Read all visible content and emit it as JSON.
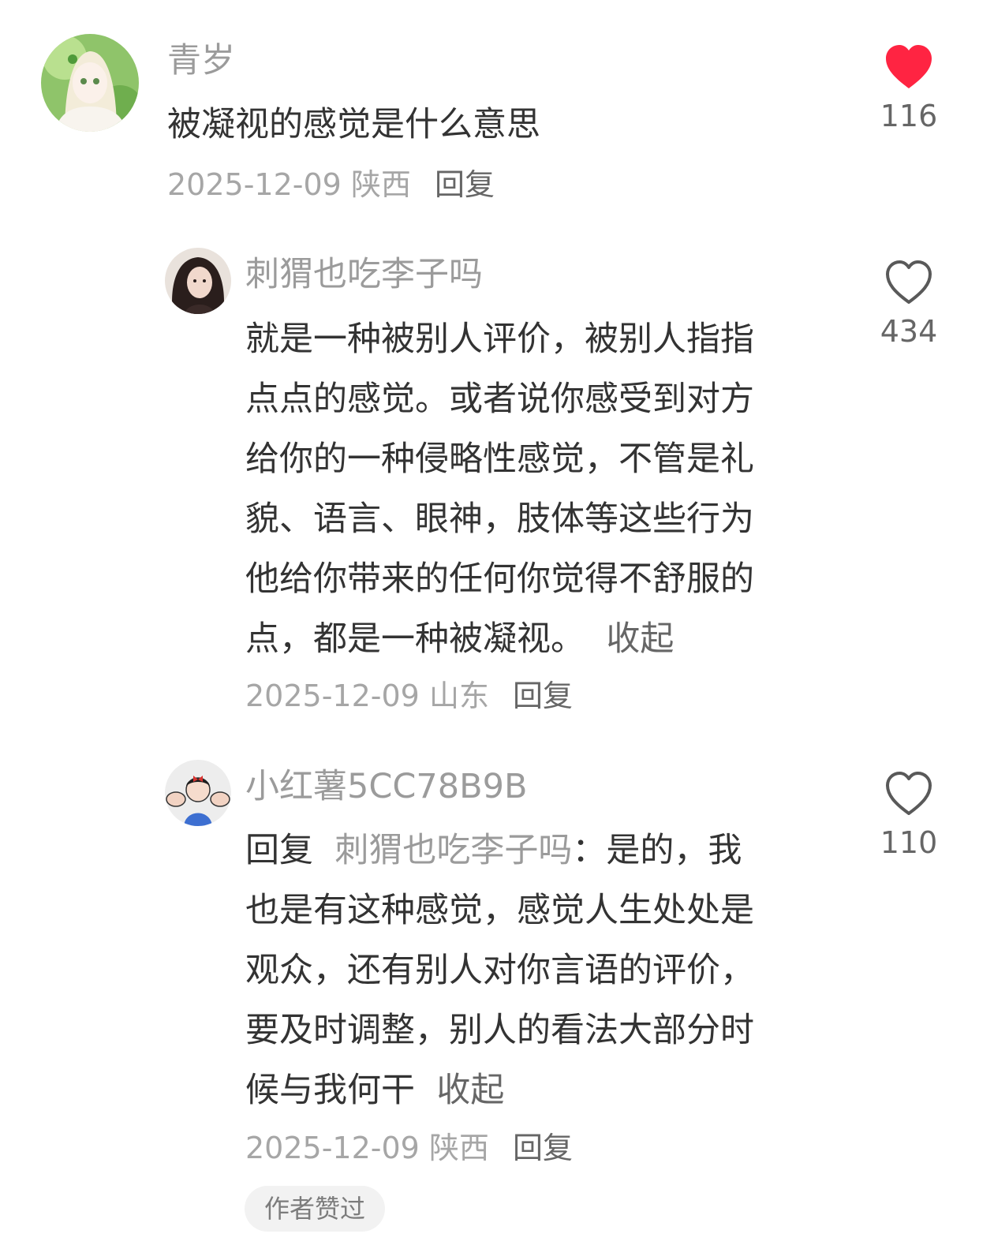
{
  "comments": [
    {
      "username": "青岁",
      "lines": [
        "被凝视的感觉是什么意思"
      ],
      "date": "2025-12-09",
      "location": "陕西",
      "reply_label": "回复",
      "like_count": "116",
      "liked": true,
      "avatar_icon": "anime-girl-avatar"
    },
    {
      "username": "刺猬也吃李子吗",
      "lines": [
        "就是一种被别人评价，被别人指指",
        "点点的感觉。或者说你感受到对方",
        "给你的一种侵略性感觉，不管是礼",
        "貌、语言、眼神，肢体等这些行为",
        "他给你带来的任何你觉得不舒服的",
        "点，都是一种被凝视。"
      ],
      "collapse_label": "收起",
      "date": "2025-12-09",
      "location": "山东",
      "reply_label": "回复",
      "like_count": "434",
      "liked": false,
      "avatar_icon": "woman-photo-avatar"
    },
    {
      "username": "小红薯5CC78B9B",
      "reply_prefix": "回复",
      "reply_target": "刺猬也吃李子吗",
      "first_line_rest": "：是的，我",
      "lines": [
        "也是有这种感觉，感觉人生处处是",
        "观众，还有别人对你言语的评价，",
        "要及时调整，别人的看法大部分时",
        "候与我何干"
      ],
      "collapse_label": "收起",
      "date": "2025-12-09",
      "location": "陕西",
      "reply_label": "回复",
      "like_count": "110",
      "liked": false,
      "author_badge": "作者赞过",
      "avatar_icon": "strong-girl-cartoon-avatar"
    }
  ],
  "colors": {
    "liked_heart": "#ff2442",
    "text": "#333333",
    "secondary": "#9b9b9b"
  }
}
